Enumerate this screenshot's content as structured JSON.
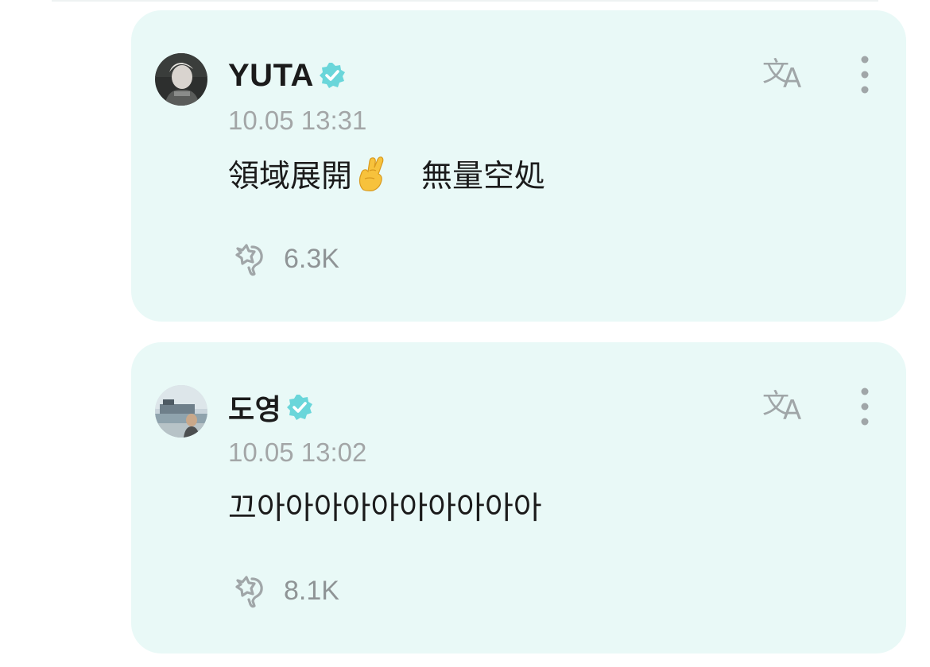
{
  "colors": {
    "card_bg": "#e9f9f7",
    "verified_badge": "#6ad6da",
    "icon_gray": "#a0a6a8",
    "text_primary": "#1b1b1b",
    "text_secondary": "#a3a6a7"
  },
  "posts": [
    {
      "author": "YUTA",
      "verified": true,
      "timestamp": "10.05 13:31",
      "text_before_emoji": "領域展開",
      "emoji": "crossed-fingers",
      "text_after_emoji": "　無量空処",
      "like_icon": "star-hand-icon",
      "likes": "6.3K"
    },
    {
      "author": "도영",
      "verified": true,
      "timestamp": "10.05 13:02",
      "text": "끄아아아아아아아아아아",
      "like_icon": "star-hand-icon",
      "likes": "8.1K"
    }
  ]
}
